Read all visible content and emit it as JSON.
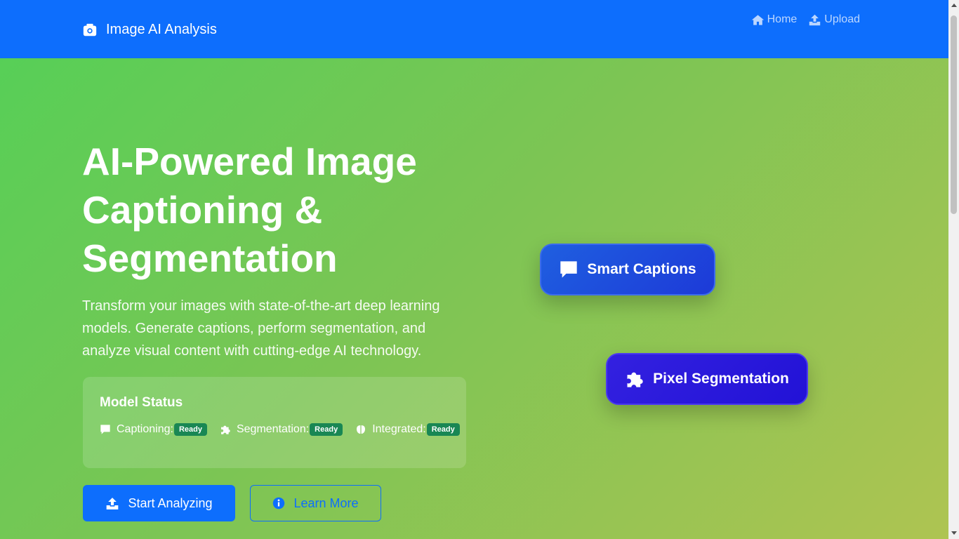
{
  "navbar": {
    "brand_icon": "camera-icon",
    "brand": "Image AI Analysis",
    "links": [
      {
        "icon": "home-icon",
        "label": "Home"
      },
      {
        "icon": "upload-icon",
        "label": "Upload"
      }
    ],
    "color": "#0d6efd"
  },
  "hero": {
    "headline": "AI-Powered Image Captioning & Segmentation",
    "lead": "Transform your images with state-of-the-art deep learning models. Generate captions, perform segmentation, and analyze visual content with cutting-edge AI technology.",
    "status": {
      "title": "Model Status",
      "items": [
        {
          "icon": "comment-icon",
          "label": "Captioning:",
          "badge": "Ready"
        },
        {
          "icon": "puzzle-icon",
          "label": "Segmentation:",
          "badge": "Ready"
        },
        {
          "icon": "brain-icon",
          "label": "Integrated:",
          "badge": "Ready"
        }
      ],
      "badge_color": "#198754"
    },
    "buttons": {
      "primary": {
        "icon": "upload-icon",
        "label": "Start Analyzing"
      },
      "secondary": {
        "icon": "info-circle-icon",
        "label": "Learn More"
      }
    }
  },
  "feature_cards": [
    {
      "icon": "comment-icon",
      "label": "Smart Captions"
    },
    {
      "icon": "puzzle-icon",
      "label": "Pixel Segmentation"
    }
  ]
}
